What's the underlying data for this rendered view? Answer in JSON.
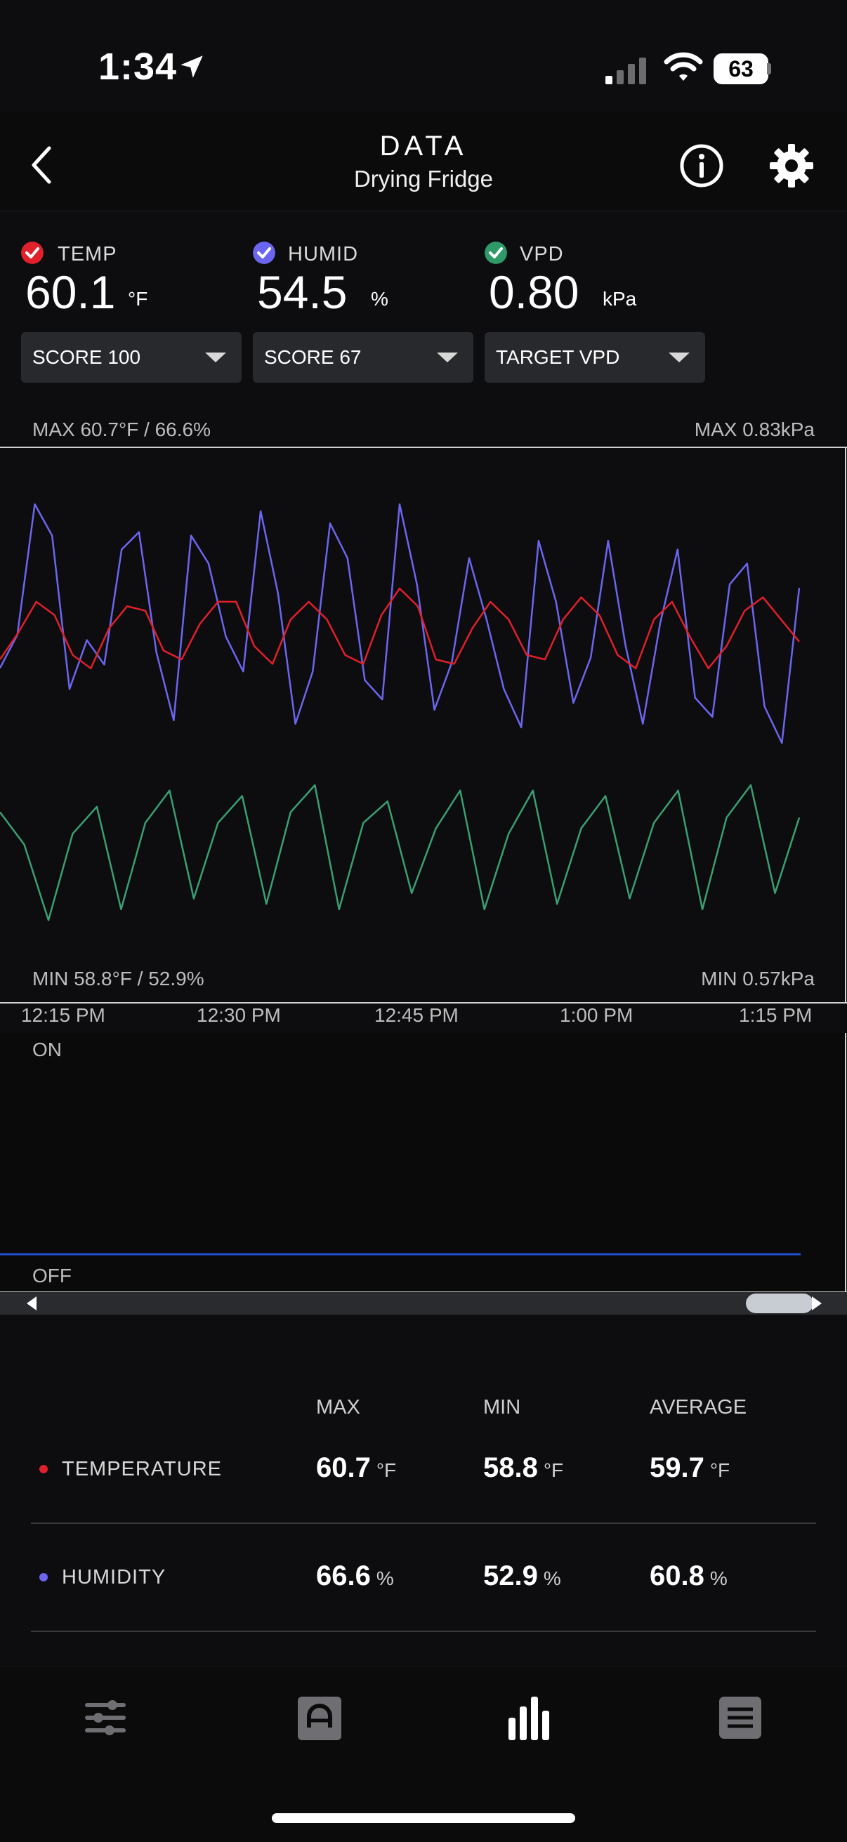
{
  "status_bar": {
    "time": "1:34",
    "battery": "63"
  },
  "header": {
    "title": "DATA",
    "subtitle": "Drying Fridge"
  },
  "metrics": [
    {
      "label": "TEMP",
      "value": "60.1",
      "unit": "°F",
      "check_color": "#e0202a",
      "select": "SCORE 100"
    },
    {
      "label": "HUMID",
      "value": "54.5",
      "unit": "%",
      "check_color": "#6b66f0",
      "select": "SCORE 67"
    },
    {
      "label": "VPD",
      "value": "0.80",
      "unit": "kPa",
      "check_color": "#2f9a68",
      "select": "TARGET VPD"
    }
  ],
  "chart": {
    "max_left": "MAX 60.7°F / 66.6%",
    "max_right": "MAX 0.83kPa",
    "min_left": "MIN 58.8°F / 52.9%",
    "min_right": "MIN 0.57kPa",
    "x_ticks": [
      "12:15 PM",
      "12:30 PM",
      "12:45 PM",
      "1:00 PM",
      "1:15 PM"
    ],
    "colors": {
      "temp": "#e0202a",
      "humid": "#6b66f0",
      "vpd": "#3a9f72",
      "device": "#1f4fd0"
    }
  },
  "chart_data": {
    "type": "line",
    "x_range": [
      "12:15 PM",
      "1:15 PM"
    ],
    "series": [
      {
        "name": "TEMP",
        "unit": "°F",
        "values": [
          59.1,
          59.7,
          60.4,
          60.1,
          59.2,
          58.9,
          59.8,
          60.3,
          60.2,
          59.3,
          59.1,
          59.9,
          60.4,
          60.4,
          59.4,
          59.0,
          60.0,
          60.4,
          60.0,
          59.2,
          59.0,
          60.1,
          60.7,
          60.3,
          59.1,
          59.0,
          59.8,
          60.4,
          60.0,
          59.2,
          59.1,
          60.0,
          60.5,
          60.1,
          59.2,
          58.9,
          60.0,
          60.4,
          59.6,
          58.9,
          59.4,
          60.2,
          60.5,
          60.0,
          59.5
        ]
      },
      {
        "name": "HUMID",
        "unit": "%",
        "values": [
          57.2,
          59.1,
          66.6,
          64.8,
          56.0,
          58.8,
          57.4,
          64.0,
          65.0,
          58.1,
          54.2,
          64.8,
          63.2,
          59.0,
          57.0,
          66.2,
          61.5,
          54.0,
          57.0,
          65.5,
          63.5,
          56.5,
          55.4,
          66.6,
          62.0,
          54.8,
          57.5,
          63.5,
          60.0,
          56.0,
          53.8,
          64.5,
          61.0,
          55.2,
          57.8,
          64.5,
          58.5,
          54.0,
          59.8,
          64.0,
          55.5,
          54.4,
          62.0,
          63.2,
          55.0,
          52.9,
          61.8
        ]
      },
      {
        "name": "VPD",
        "unit": "kPa",
        "values": [
          0.78,
          0.72,
          0.58,
          0.74,
          0.79,
          0.6,
          0.76,
          0.82,
          0.62,
          0.76,
          0.81,
          0.61,
          0.78,
          0.83,
          0.6,
          0.76,
          0.8,
          0.63,
          0.75,
          0.82,
          0.6,
          0.74,
          0.82,
          0.61,
          0.75,
          0.81,
          0.62,
          0.76,
          0.82,
          0.6,
          0.77,
          0.83,
          0.63,
          0.77
        ]
      },
      {
        "name": "device",
        "values": [
          0,
          0
        ]
      }
    ]
  },
  "device_panel": {
    "on_label": "ON",
    "off_label": "OFF"
  },
  "stats": {
    "headers": [
      "MAX",
      "MIN",
      "AVERAGE"
    ],
    "rows": [
      {
        "label": "TEMPERATURE",
        "dot": "#e0202a",
        "max": "60.7",
        "min": "58.8",
        "avg": "59.7",
        "unit": "°F"
      },
      {
        "label": "HUMIDITY",
        "dot": "#6b66f0",
        "max": "66.6",
        "min": "52.9",
        "avg": "60.8",
        "unit": "%"
      }
    ]
  },
  "tabbar": {
    "icons": [
      "sliders-icon",
      "controller-icon",
      "bar-chart-icon",
      "log-icon"
    ],
    "active": "bar-chart-icon"
  }
}
